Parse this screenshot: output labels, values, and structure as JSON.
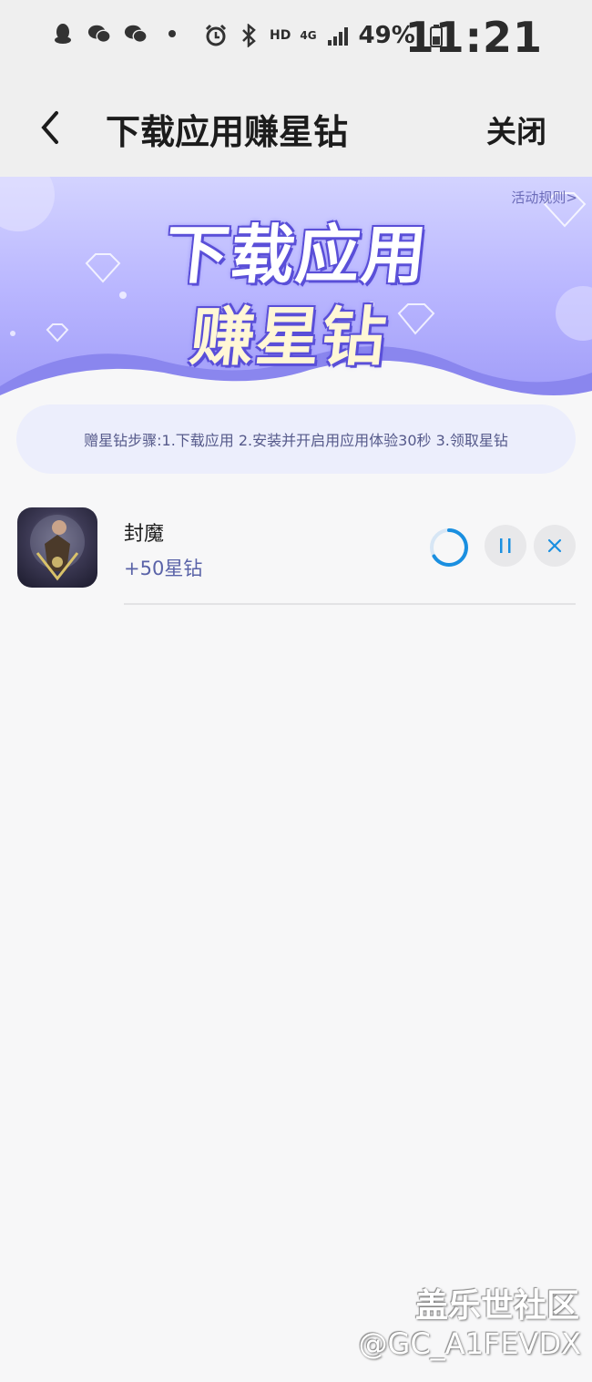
{
  "status_bar": {
    "icons_left": [
      "qq-penguin-icon",
      "wechat-icon",
      "wechat-icon",
      "dot-icon"
    ],
    "icons_right": [
      "alarm-icon",
      "bluetooth-icon"
    ],
    "hd_label": "HD",
    "network_label": "4G",
    "battery_percent": "49%",
    "time": "11:21"
  },
  "header": {
    "title": "下载应用赚星钻",
    "close_label": "关闭"
  },
  "banner": {
    "rules_link": "活动规则>",
    "line1": "下载应用",
    "line2": "赚星钻",
    "colors": {
      "bg_light": "#d3d3ff",
      "bg_dark": "#9f9bf8",
      "title_outline": "#5a4fd8"
    }
  },
  "steps": {
    "text": "赠星钻步骤:1.下载应用 2.安装并开启用应用体验30秒 3.领取星钻"
  },
  "apps": [
    {
      "name": "封魔",
      "reward": "+50星钻",
      "actions": [
        "pause-icon",
        "close-icon"
      ]
    }
  ],
  "watermark": {
    "line1": "盖乐世社区",
    "line2": "@GC_A1FEVDX"
  },
  "colors": {
    "accent": "#1a8fe0",
    "reward_text": "#5a63a8"
  }
}
